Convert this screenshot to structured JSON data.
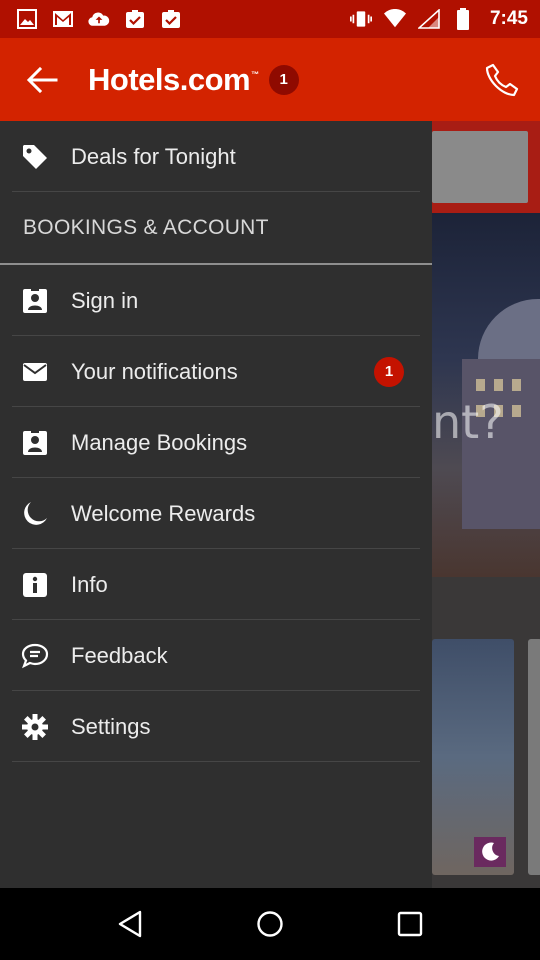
{
  "status_bar": {
    "time": "7:45",
    "left_icons": [
      "image-icon",
      "gmail-icon",
      "cloud-upload-icon",
      "clipboard-check-icon",
      "clipboard-check-icon"
    ],
    "right_icons": [
      "vibrate-icon",
      "wifi-icon",
      "signal-icon",
      "battery-icon"
    ]
  },
  "header": {
    "logo_text": "Hotels.com",
    "logo_tm": "™",
    "notification_count": "1"
  },
  "drawer": {
    "top_item": {
      "label": "Deals for Tonight",
      "icon": "tag-icon"
    },
    "section_title": "BOOKINGS & ACCOUNT",
    "items": [
      {
        "label": "Sign in",
        "icon": "contact-card-icon"
      },
      {
        "label": "Your notifications",
        "icon": "envelope-icon",
        "badge": "1"
      },
      {
        "label": "Manage Bookings",
        "icon": "contact-card-icon"
      },
      {
        "label": "Welcome Rewards",
        "icon": "moon-icon"
      },
      {
        "label": "Info",
        "icon": "info-icon"
      },
      {
        "label": "Feedback",
        "icon": "chat-bubble-icon"
      },
      {
        "label": "Settings",
        "icon": "gear-icon"
      }
    ]
  },
  "background": {
    "partial_text": "nt?"
  },
  "colors": {
    "status_bar": "#b01000",
    "app_bar": "#d32300",
    "drawer": "#2f2f2f",
    "badge": "#c41200"
  }
}
